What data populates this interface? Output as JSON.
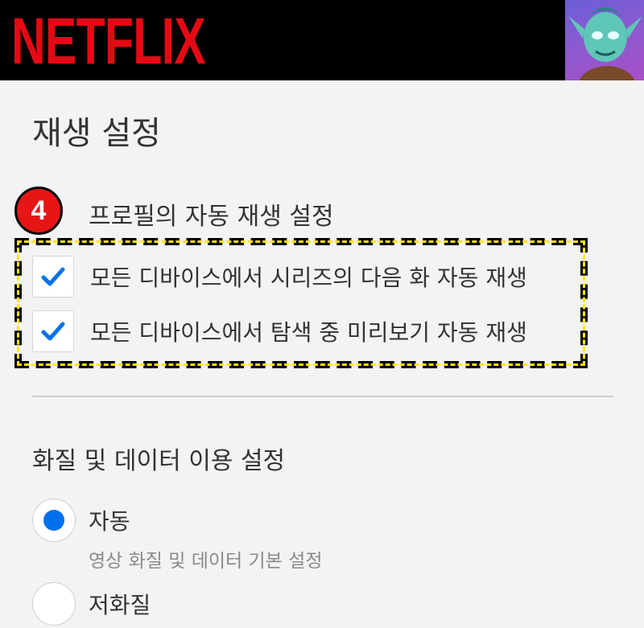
{
  "header": {
    "logo_text": "NETFLIX",
    "brand_color": "#e50914",
    "avatar_icon": "profile-avatar-icon"
  },
  "page": {
    "title": "재생 설정"
  },
  "annotation": {
    "step_number": "4",
    "badge_color": "#e61616",
    "highlight_colors": [
      "#000000",
      "#ffe800"
    ]
  },
  "autoplay": {
    "heading": "프로필의 자동 재생 설정",
    "options": [
      {
        "label": "모든 디바이스에서 시리즈의 다음 화 자동 재생",
        "checked": true
      },
      {
        "label": "모든 디바이스에서 탐색 중 미리보기 자동 재생",
        "checked": true
      }
    ],
    "check_color": "#0071eb"
  },
  "quality": {
    "heading": "화질 및 데이터 이용 설정",
    "options": [
      {
        "label": "자동",
        "description": "영상 화질 및 데이터 기본 설정",
        "selected": true
      },
      {
        "label": "저화질",
        "selected": false
      }
    ],
    "accent_color": "#0071eb"
  }
}
